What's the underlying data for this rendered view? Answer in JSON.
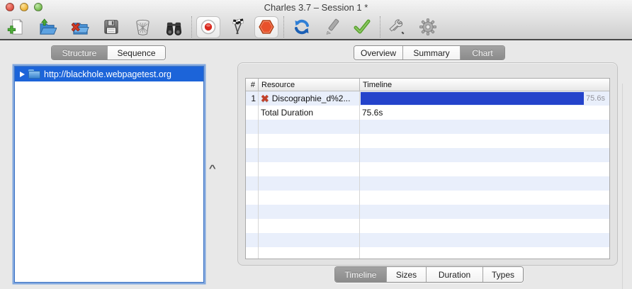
{
  "window": {
    "title": "Charles 3.7 – Session 1 *",
    "traffic_lights": [
      "close",
      "minimize",
      "zoom"
    ]
  },
  "toolbar": {
    "icons": [
      {
        "name": "new-session-icon"
      },
      {
        "name": "open-session-icon"
      },
      {
        "name": "close-session-icon"
      },
      {
        "name": "save-session-icon"
      },
      {
        "name": "clear-session-icon"
      },
      {
        "name": "find-icon"
      },
      {
        "name": "record-icon",
        "button_background": true
      },
      {
        "name": "throttling-flags-icon"
      },
      {
        "name": "breakpoints-icon",
        "button_background": true
      },
      {
        "name": "repeat-icon"
      },
      {
        "name": "compose-icon"
      },
      {
        "name": "validate-icon"
      },
      {
        "name": "tools-icon"
      },
      {
        "name": "settings-gear-icon"
      }
    ]
  },
  "left_panel": {
    "tabs": [
      {
        "label": "Structure",
        "selected": true
      },
      {
        "label": "Sequence",
        "selected": false
      }
    ],
    "tree": [
      {
        "label": "http://blackhole.webpagetest.org",
        "selected": true,
        "icon": "folder-icon",
        "expandable": true
      }
    ]
  },
  "right_panel": {
    "tabs": [
      {
        "label": "Overview",
        "selected": false
      },
      {
        "label": "Summary",
        "selected": false
      },
      {
        "label": "Chart",
        "selected": true
      }
    ],
    "table": {
      "columns": [
        "#",
        "Resource",
        "Timeline"
      ],
      "rows": [
        {
          "num": "1",
          "icon": "failed-request-icon",
          "resource": "Discographie_d%2...",
          "bar_label": "75.6s",
          "bar_pct": 89.5
        },
        {
          "num": "",
          "resource": "Total Duration",
          "timeline_text": "75.6s"
        }
      ],
      "empty_row_count": 10
    },
    "bottom_tabs": [
      {
        "label": "Timeline",
        "selected": true
      },
      {
        "label": "Sizes",
        "selected": false
      },
      {
        "label": "Duration",
        "selected": false
      },
      {
        "label": "Types",
        "selected": false
      }
    ]
  },
  "chart_data": {
    "type": "bar",
    "orientation": "horizontal",
    "categories": [
      "Discographie_d%2..."
    ],
    "values_seconds": [
      75.6
    ],
    "total_duration_seconds": 75.6,
    "value_labels": [
      "75.6s"
    ],
    "xlabel": "Timeline",
    "bar_color": "#2443cb"
  },
  "colors": {
    "selection_blue": "#1c64d9",
    "timeline_bar_blue": "#2443cb",
    "row_stripe_blue": "#e9effb",
    "failed_icon_red": "#c2402a",
    "breakpoint_orange": "#e8512b",
    "record_red": "#d8281e"
  }
}
